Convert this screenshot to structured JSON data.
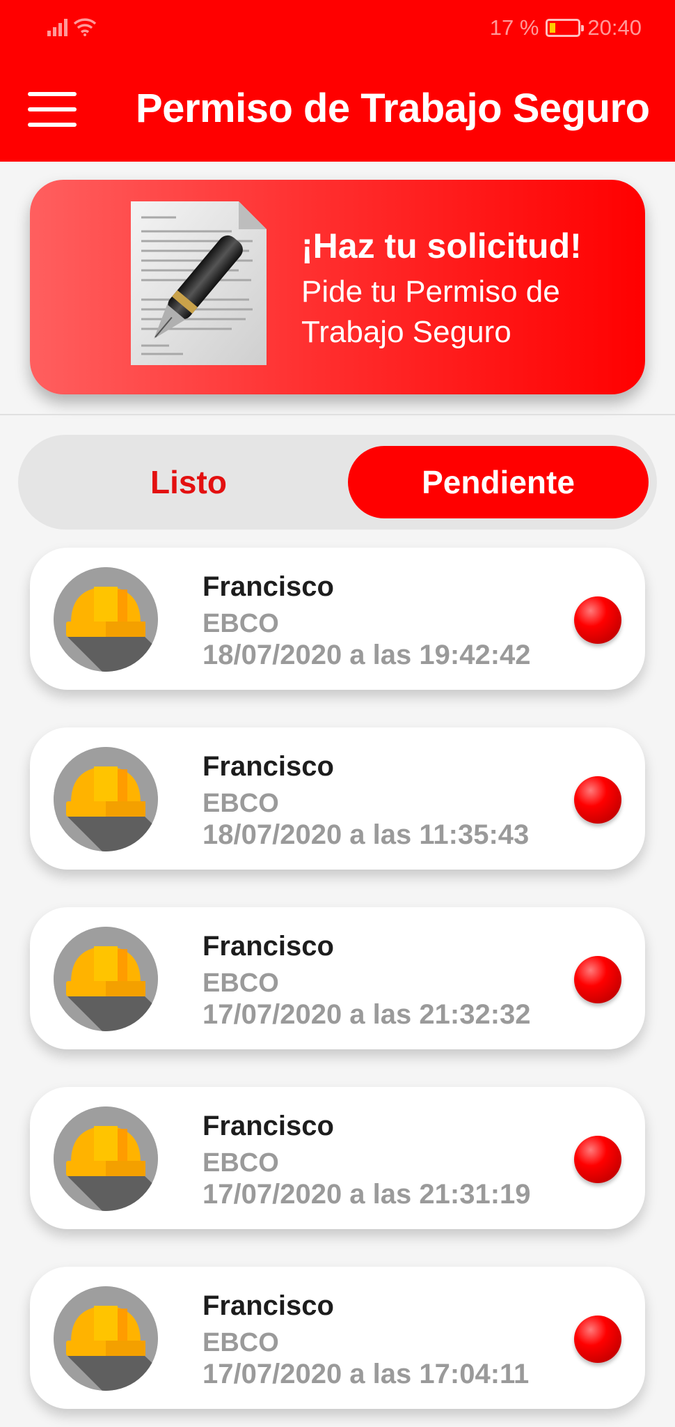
{
  "status_bar": {
    "battery": "17 %",
    "time": "20:40"
  },
  "header": {
    "title": "Permiso de Trabajo Seguro",
    "menu_icon": "hamburger-menu-icon"
  },
  "banner": {
    "title": "¡Haz tu solicitud!",
    "subtitle": "Pide tu Permiso de Trabajo Seguro",
    "image": "document-pen-icon"
  },
  "tabs": {
    "listo": "Listo",
    "pendiente": "Pendiente",
    "selected": "Pendiente"
  },
  "colors": {
    "primary": "#ff0000",
    "status_pending": "#e00000"
  },
  "permits": [
    {
      "name": "Francisco",
      "company": "EBCO",
      "date": "18/07/2020 a las 19:42:42",
      "status": "pending",
      "icon": "hard-hat-icon"
    },
    {
      "name": "Francisco",
      "company": "EBCO",
      "date": "18/07/2020 a las 11:35:43",
      "status": "pending",
      "icon": "hard-hat-icon"
    },
    {
      "name": "Francisco",
      "company": "EBCO",
      "date": "17/07/2020 a las 21:32:32",
      "status": "pending",
      "icon": "hard-hat-icon"
    },
    {
      "name": "Francisco",
      "company": "EBCO",
      "date": "17/07/2020 a las 21:31:19",
      "status": "pending",
      "icon": "hard-hat-icon"
    },
    {
      "name": "Francisco",
      "company": "EBCO",
      "date": "17/07/2020 a las 17:04:11",
      "status": "pending",
      "icon": "hard-hat-icon"
    }
  ]
}
